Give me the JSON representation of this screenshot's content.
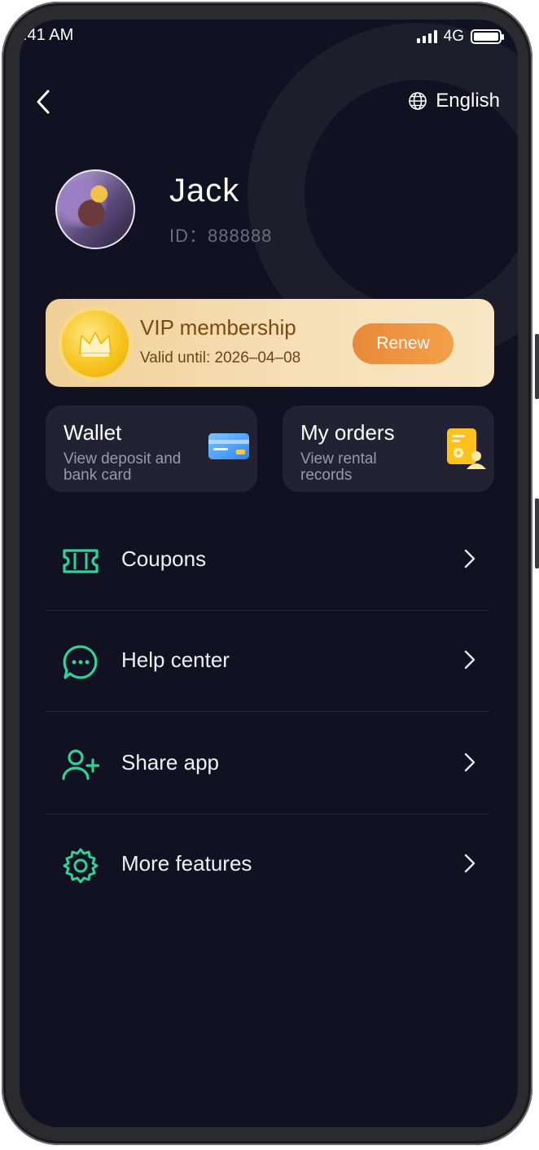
{
  "status_bar": {
    "time": ":41 AM",
    "network": "4G"
  },
  "header": {
    "language_label": "English"
  },
  "profile": {
    "name": "Jack",
    "id_text": "ID：888888"
  },
  "vip": {
    "title": "VIP membership",
    "valid_until": "Valid until: 2026–04–08",
    "renew_label": "Renew"
  },
  "tiles": [
    {
      "title": "Wallet",
      "subtitle": "View deposit and bank card",
      "icon": "bank-card-icon"
    },
    {
      "title": "My orders",
      "subtitle": "View rental records",
      "icon": "order-document-icon"
    }
  ],
  "menu": [
    {
      "label": "Coupons",
      "icon": "ticket-icon"
    },
    {
      "label": "Help center",
      "icon": "chat-bubble-icon"
    },
    {
      "label": "Share app",
      "icon": "add-user-icon"
    },
    {
      "label": "More features",
      "icon": "gear-icon"
    }
  ],
  "colors": {
    "background": "#121121",
    "accent_green": "#2fd39a",
    "vip_gold": "#f0cf97",
    "renew_orange": "#ee9440",
    "tile_bg": "#232232"
  }
}
